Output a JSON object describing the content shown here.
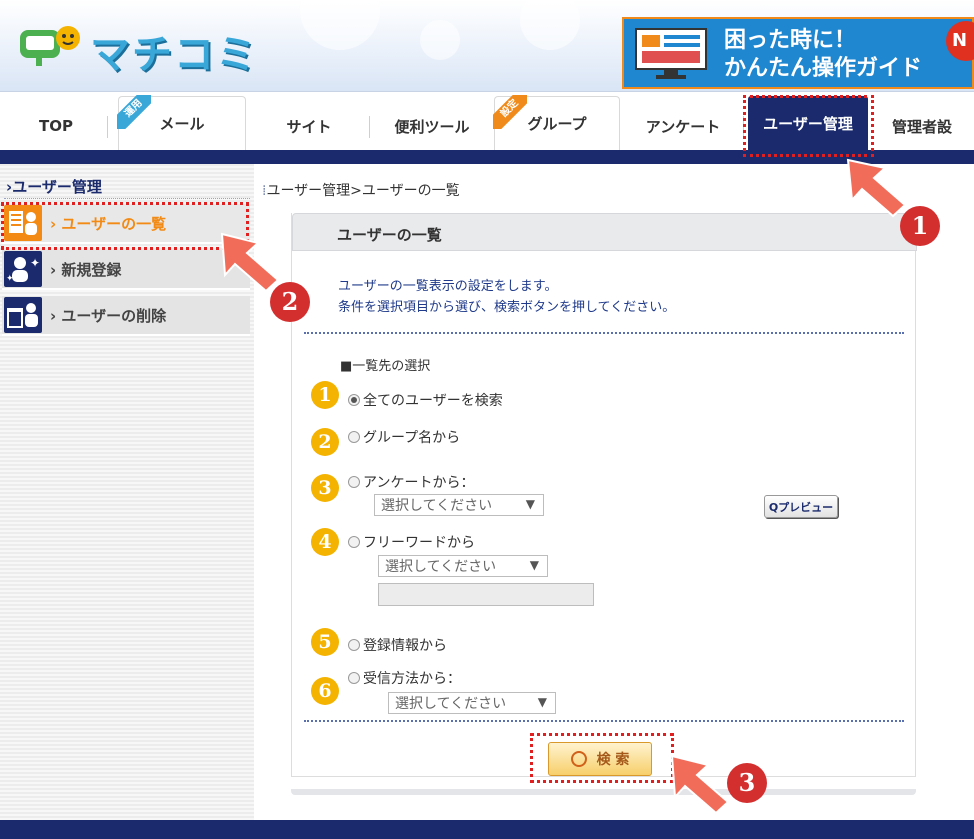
{
  "header": {
    "logo_text": "マチコミ",
    "guide_line1": "困った時に！",
    "guide_line2": "かんたん操作ガイド",
    "guide_badge": "N"
  },
  "tabs": [
    {
      "label": "TOP"
    },
    {
      "label": "メール",
      "ribbon": "運用"
    },
    {
      "label": "サイト"
    },
    {
      "label": "便利ツール"
    },
    {
      "label": "グループ",
      "ribbon": "設定"
    },
    {
      "label": "アンケート"
    },
    {
      "label": "ユーザー管理",
      "active": true
    },
    {
      "label": "管理者設"
    }
  ],
  "sidebar": {
    "title": "ユーザー管理",
    "items": [
      {
        "label": "ユーザーの一覧",
        "icon": "user-list-icon",
        "active": true
      },
      {
        "label": "新規登録",
        "icon": "new-user-icon"
      },
      {
        "label": "ユーザーの削除",
        "icon": "trash-user-icon"
      }
    ]
  },
  "breadcrumb": "ユーザー管理>ユーザーの一覧",
  "panel": {
    "title": "ユーザーの一覧",
    "desc1": "ユーザーの一覧表示の設定をします。",
    "desc2": "条件を選択項目から選び、検索ボタンを押してください。",
    "section_label": "■一覧先の選択",
    "options": [
      {
        "num": "1",
        "label": "全てのユーザーを検索",
        "checked": true
      },
      {
        "num": "2",
        "label": "グループ名から"
      },
      {
        "num": "3",
        "label": "アンケートから："
      },
      {
        "num": "4",
        "label": "フリーワードから"
      },
      {
        "num": "5",
        "label": "登録情報から"
      },
      {
        "num": "6",
        "label": "受信方法から："
      }
    ],
    "select_placeholder": "選択してください",
    "preview_label": "Qプレビュー",
    "search_label": "検 索"
  },
  "callouts": [
    "1",
    "2",
    "3"
  ],
  "colors": {
    "navy": "#1a2a6c",
    "accent_orange": "#f28a14",
    "number_badge": "#f4b300",
    "callout_red": "#d32f2f"
  }
}
